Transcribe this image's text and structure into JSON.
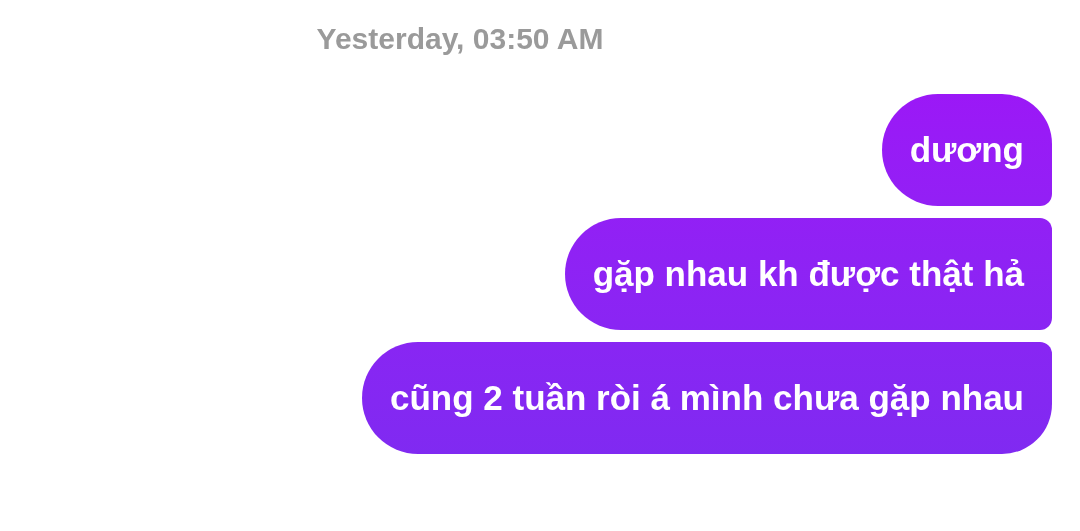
{
  "timestamp": "Yesterday, 03:50 AM",
  "messages": [
    {
      "text": "dương"
    },
    {
      "text": "gặp nhau kh được thật hả"
    },
    {
      "text": "cũng 2 tuần ròi á mình chưa gặp nhau"
    }
  ]
}
